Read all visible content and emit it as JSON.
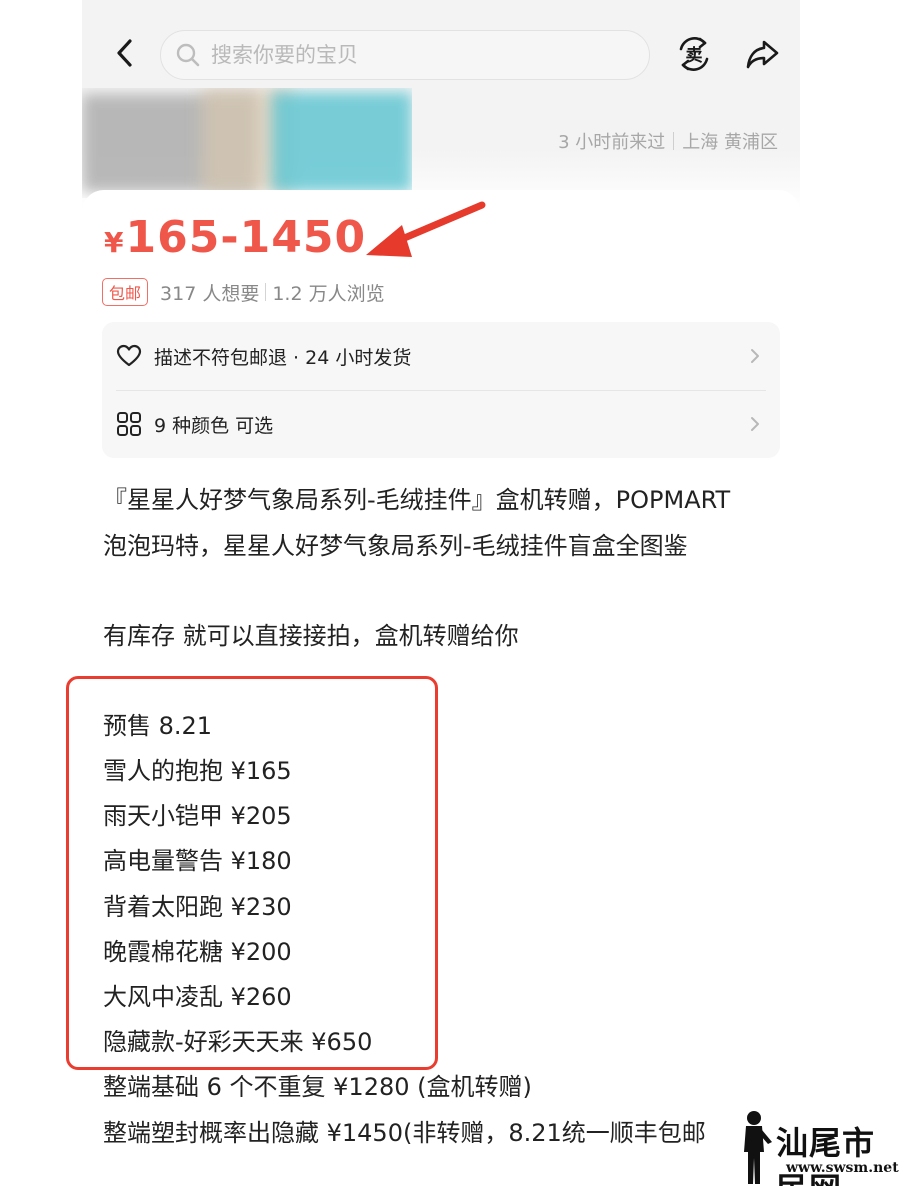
{
  "header": {
    "search_placeholder": "搜索你要的宝贝",
    "last_seen": "3 小时前来过",
    "location": "上海 黄浦区",
    "icons": [
      "back-arrow-icon",
      "search-icon",
      "sell-icon",
      "share-icon"
    ],
    "sell_icon_char": "卖"
  },
  "price": {
    "currency": "¥",
    "range": "165-1450",
    "color": "#f0574b"
  },
  "tags": {
    "free_shipping": "包邮",
    "wants": "317 人想要",
    "views": "1.2 万人浏览"
  },
  "info": {
    "guarantee": "描述不符包邮退 · 24 小时发货",
    "options": "9 种颜色 可选"
  },
  "description": {
    "line1": "『星星人好梦气象局系列-毛绒挂件』盒机转赠，POPMART",
    "line2": "泡泡玛特，星星人好梦气象局系列-毛绒挂件盲盒全图鉴",
    "stock_note": "有库存 就可以直接接拍，盒机转赠给你",
    "items": [
      "预售 8.21",
      "雪人的抱抱 ¥165",
      "雨天小铠甲 ¥205",
      "高电量警告 ¥180",
      "背着太阳跑 ¥230",
      "晚霞棉花糖 ¥200",
      "大风中凌乱 ¥260",
      "隐藏款-好彩天天来 ¥650"
    ],
    "extra1": "整端基础 6 个不重复 ¥1280 (盒机转赠)",
    "extra2": "整端塑封概率出隐藏 ¥1450(非转赠，8.21统一顺丰包邮"
  },
  "watermark": {
    "text": "汕尾市民网",
    "url": "www.swsm.net"
  },
  "colors": {
    "accent_red": "#f0574b",
    "highlight_box": "#ea3d2f",
    "muted_text": "#a7a7a7"
  }
}
